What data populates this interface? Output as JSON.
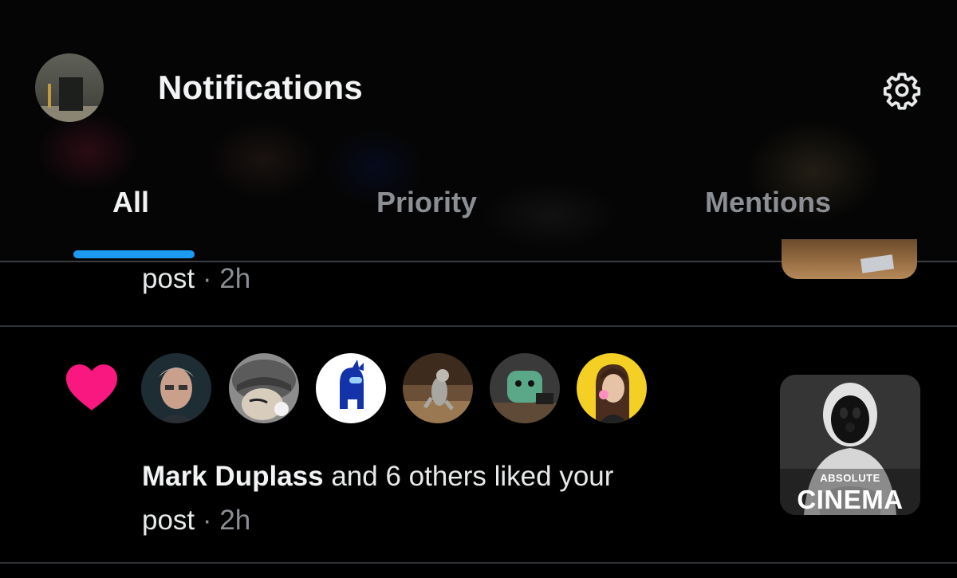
{
  "header": {
    "title": "Notifications",
    "profile_avatar_icon": "user-avatar",
    "settings_icon": "gear-icon"
  },
  "tabs": [
    {
      "label": "All",
      "selected": true
    },
    {
      "label": "Priority",
      "selected": false
    },
    {
      "label": "Mentions",
      "selected": false
    }
  ],
  "colors": {
    "accent": "#1d9bf0",
    "like": "#f91880",
    "background": "#000000",
    "muted_text": "#8b8f94"
  },
  "previous_notification": {
    "text": "post",
    "separator": "·",
    "time": "2h"
  },
  "notification": {
    "type_icon": "heart-icon",
    "likers": [
      {
        "name": "Mark Duplass"
      },
      {
        "name": "liker-2"
      },
      {
        "name": "liker-3"
      },
      {
        "name": "liker-4"
      },
      {
        "name": "liker-5"
      },
      {
        "name": "liker-6"
      }
    ],
    "actor": "Mark Duplass",
    "action": " and 6 others liked your",
    "object": "post",
    "separator": "·",
    "time": "2h",
    "thumbnail": {
      "caption_small": "ABSOLUTE",
      "caption_big": "CINEMA"
    }
  }
}
